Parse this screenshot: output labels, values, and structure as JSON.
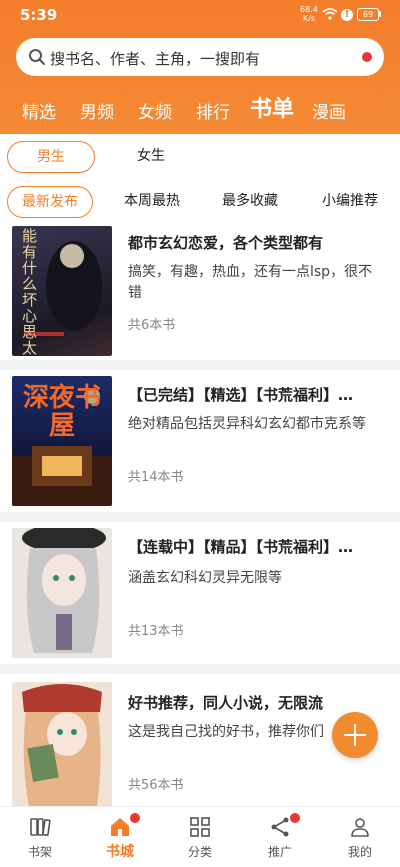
{
  "status": {
    "time": "5:39",
    "net_speed": "68.4",
    "net_unit": "K/s",
    "battery": "69"
  },
  "search": {
    "placeholder": "搜书名、作者、主角，一搜即有"
  },
  "categories": [
    "精选",
    "男频",
    "女频",
    "排行",
    "书单",
    "漫画"
  ],
  "active_category": "书单",
  "gender_tabs": [
    "男生",
    "女生"
  ],
  "active_gender": "男生",
  "sort_tabs": [
    "最新发布",
    "本周最热",
    "最多收藏",
    "小编推荐"
  ],
  "active_sort": "最新发布",
  "booklists": [
    {
      "title": "都市玄幻恋爱，各个类型都有",
      "desc": "搞笑，有趣，热血，还有一点lsp，很不错",
      "count": "共6本书",
      "cover": {
        "text": "能有什么坏心思 太监",
        "bg": "#2b2a3a"
      }
    },
    {
      "title": "【已完结】【精选】【书荒福利】…",
      "desc": "绝对精品包括灵异科幻玄幻都市克系等",
      "count": "共14本书",
      "cover": {
        "text": "深夜书屋",
        "bg": "#1e2350"
      }
    },
    {
      "title": "【连载中】【精品】【书荒福利】…",
      "desc": "涵盖玄幻科幻灵异无限等",
      "count": "共13本书",
      "cover": {
        "text": "",
        "bg": "#d9d4cf"
      }
    },
    {
      "title": "好书推荐，同人小说，无限流",
      "desc": "这是我自己找的好书，推荐你们",
      "count": "共56本书",
      "cover": {
        "text": "",
        "bg": "#e8c9b8"
      }
    }
  ],
  "bottom_nav": [
    {
      "label": "书架",
      "icon": "bookshelf-icon",
      "badge": false
    },
    {
      "label": "书城",
      "icon": "bookstore-icon",
      "badge": true
    },
    {
      "label": "分类",
      "icon": "category-icon",
      "badge": false
    },
    {
      "label": "推广",
      "icon": "share-icon",
      "badge": true
    },
    {
      "label": "我的",
      "icon": "profile-icon",
      "badge": false
    }
  ],
  "active_nav": "书城",
  "colors": {
    "accent": "#f47d2a",
    "badge": "#e53935"
  }
}
